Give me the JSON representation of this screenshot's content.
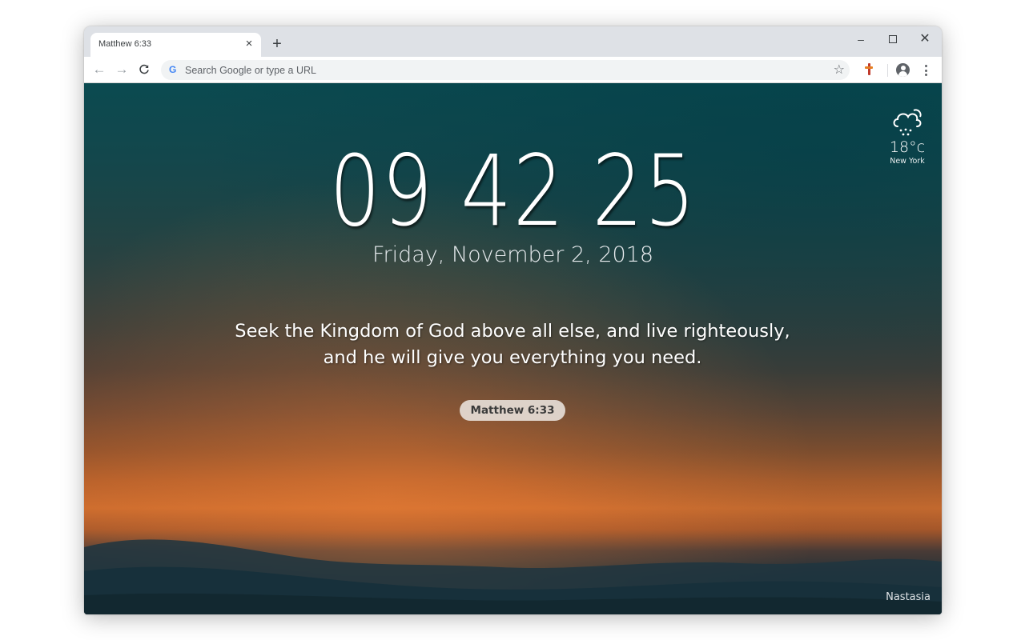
{
  "browser": {
    "tab_title": "Matthew 6:33",
    "tab_close": "×",
    "new_tab": "+",
    "window_controls": {
      "minimize": "–",
      "close": "✕"
    },
    "nav": {
      "back": "←",
      "forward": "→",
      "reload": "C"
    },
    "omnibox": {
      "icon": "G",
      "placeholder": "Search Google or type a URL",
      "value": ""
    },
    "bookmark": "☆"
  },
  "clock": {
    "time": "09 42 25",
    "date": "Friday, November 2, 2018"
  },
  "verse": {
    "line1": "Seek the Kingdom of God above all else, and live righteously,",
    "line2": "and he will give you everything you need.",
    "reference": "Matthew 6:33"
  },
  "weather": {
    "temp": "18°c",
    "city": "New York",
    "icon": "cloud-rain-icon"
  },
  "photo_credit": "Nastasia",
  "colors": {
    "sky_top": "#0b4a50",
    "sunset": "#c96a2d",
    "pill_bg": "#ebe4de"
  }
}
